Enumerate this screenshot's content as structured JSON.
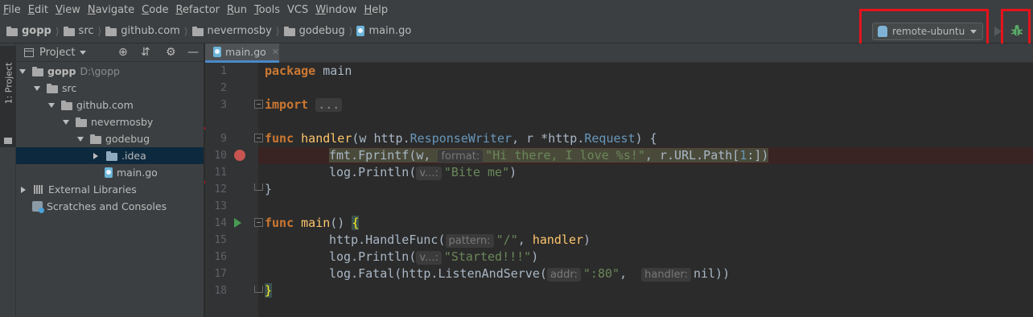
{
  "menu": {
    "items": [
      {
        "u": "F",
        "rest": "ile"
      },
      {
        "u": "E",
        "rest": "dit"
      },
      {
        "u": "V",
        "rest": "iew"
      },
      {
        "u": "N",
        "rest": "avigate"
      },
      {
        "u": "C",
        "rest": "ode"
      },
      {
        "u": "R",
        "rest": "efactor"
      },
      {
        "u": "R",
        "rest": "un"
      },
      {
        "u": "T",
        "rest": "ools"
      },
      {
        "u": "",
        "rest": "VCS"
      },
      {
        "u": "W",
        "rest": "indow"
      },
      {
        "u": "H",
        "rest": "elp"
      }
    ]
  },
  "breadcrumb": [
    "gopp",
    "src",
    "github.com",
    "nevermosby",
    "godebug",
    "main.go"
  ],
  "run_config": {
    "label": "remote-ubuntu"
  },
  "tool_strip": {
    "project_tab": "1: Project"
  },
  "project_panel": {
    "title": "Project",
    "tree": [
      {
        "label": "gopp",
        "suffix": "D:\\gopp",
        "depth": 0,
        "expanded": true,
        "kind": "folder",
        "bold": true
      },
      {
        "label": "src",
        "depth": 1,
        "expanded": true,
        "kind": "folder"
      },
      {
        "label": "github.com",
        "depth": 2,
        "expanded": true,
        "kind": "folder"
      },
      {
        "label": "nevermosby",
        "depth": 3,
        "expanded": true,
        "kind": "folder"
      },
      {
        "label": "godebug",
        "depth": 4,
        "expanded": true,
        "kind": "folder"
      },
      {
        "label": ".idea",
        "depth": 5,
        "expanded": false,
        "kind": "folder",
        "selected": true
      },
      {
        "label": "main.go",
        "depth": 5,
        "kind": "gofile"
      },
      {
        "label": "External Libraries",
        "depth": 0,
        "expanded": false,
        "kind": "lib"
      },
      {
        "label": "Scratches and Consoles",
        "depth": 0,
        "kind": "scratch"
      }
    ]
  },
  "editor": {
    "tab": "main.go",
    "line_numbers": [
      "1",
      "2",
      "3",
      "9",
      "10",
      "11",
      "12",
      "13",
      "14",
      "15",
      "16",
      "17",
      "18"
    ],
    "code": {
      "l1_kw": "package",
      "l1_rest": " main",
      "l3_kw": "import",
      "l3_fold": "...",
      "l9_kw": "func",
      "l9_name": "handler",
      "l9_a": "(w http.",
      "l9_t1": "ResponseWriter",
      "l9_b": ", r *http.",
      "l9_t2": "Request",
      "l9_c": ") {",
      "l10_a": "fmt.Fprintf(w, ",
      "l10_hint": "format:",
      "l10_str": "\"Hi there, I love %s!\"",
      "l10_b": ", r.URL.Path[",
      "l10_num": "1",
      "l10_c": ":])",
      "l11_a": "log.Println(",
      "l11_hint": "v...:",
      "l11_str": "\"Bite me\"",
      "l11_b": ")",
      "l12": "}",
      "l14_kw": "func",
      "l14_name": "main",
      "l14_a": "() ",
      "l14_brace": "{",
      "l15_a": "http.HandleFunc(",
      "l15_hint": "pattern:",
      "l15_str": "\"/\"",
      "l15_b": ", ",
      "l15_fn": "handler",
      "l15_c": ")",
      "l16_a": "log.Println(",
      "l16_hint": "v...:",
      "l16_str": "\"Started!!!\"",
      "l16_b": ")",
      "l17_a": "log.Fatal(http.ListenAndServe(",
      "l17_hint1": "addr:",
      "l17_str": "\":80\"",
      "l17_b": ",  ",
      "l17_hint2": "handler:",
      "l17_c": "nil))",
      "l18": "}"
    }
  },
  "colors": {
    "annotation_box": "#e5131c",
    "keyword": "#cc7832",
    "function": "#ffc66d",
    "string": "#6a8759",
    "number": "#6897bb"
  }
}
